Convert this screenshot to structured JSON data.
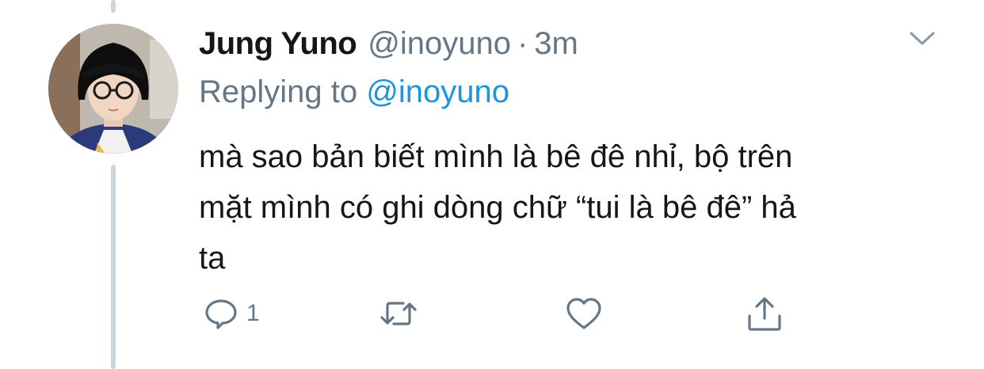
{
  "tweet": {
    "author_name": "Jung Yuno",
    "author_handle": "@inoyuno",
    "separator": "·",
    "timestamp": "3m",
    "replying_prefix": "Replying to",
    "replying_to": "@inoyuno",
    "text_lines": [
      "mà sao bản biết mình là bê đê nhỉ, bộ trên",
      "mặt mình có ghi dòng chữ “tui là bê đê” hả",
      "ta"
    ]
  },
  "actions": {
    "reply": {
      "icon": "reply-icon",
      "count": "1"
    },
    "retweet": {
      "icon": "retweet-icon"
    },
    "like": {
      "icon": "heart-icon"
    },
    "share": {
      "icon": "share-icon"
    }
  },
  "colors": {
    "text": "#14171a",
    "secondary": "#657786",
    "link": "#1b95e0",
    "thread_line": "#ccd6dd"
  }
}
